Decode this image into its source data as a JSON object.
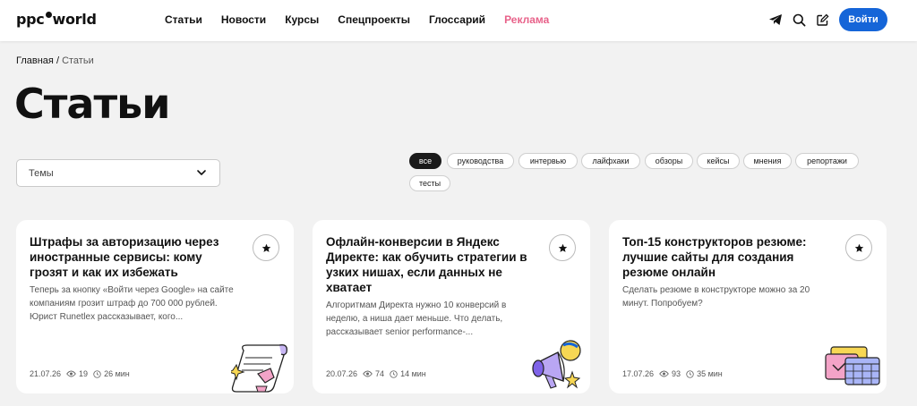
{
  "header": {
    "logo_left": "ppc",
    "logo_right": "world",
    "nav": [
      "Статьи",
      "Новости",
      "Курсы",
      "Спецпроекты",
      "Глоссарий",
      "Реклама"
    ],
    "login_label": "Войти"
  },
  "breadcrumb": {
    "home": "Главная",
    "separator": "/",
    "current": "Статьи"
  },
  "page_title": "Статьи",
  "filter": {
    "topics_label": "Темы"
  },
  "chips": [
    "все",
    "руководства",
    "интервью",
    "лайфхаки",
    "обзоры",
    "кейсы",
    "мнения",
    "репортажи",
    "тесты"
  ],
  "active_chip": "все",
  "cards": [
    {
      "title": "Штрафы за авторизацию через иностранные сервисы: кому грозят и как их избежать",
      "description": "Теперь за кнопку «Войти через Google» на сайте компаниям грозит штраф до 700 000 рублей. Юрист Runetlex рассказывает, кого...",
      "date": "21.07.26",
      "views": "19",
      "read_time": "26 мин"
    },
    {
      "title": "Офлайн-конверсии в Яндекс Директе: как обучить стратегии в узких нишах, если данных не хватает",
      "description": "Алгоритмам Директа нужно 10 конверсий в неделю, а ниша дает меньше. Что делать, рассказывает senior performance-...",
      "date": "20.07.26",
      "views": "74",
      "read_time": "14 мин"
    },
    {
      "title": "Топ-15 конструкторов резюме: лучшие сайты для создания резюме онлайн",
      "description": "Сделать резюме в конструкторе можно за 20 минут. Попробуем?",
      "date": "17.07.26",
      "views": "93",
      "read_time": "35 мин"
    }
  ],
  "colors": {
    "accent": "#1565d8",
    "ad_link": "#e8628a",
    "background": "#f2f2f2"
  },
  "icons": [
    "telegram-icon",
    "search-icon",
    "edit-icon",
    "chevron-down-icon",
    "star-icon",
    "eye-icon",
    "clock-icon"
  ]
}
